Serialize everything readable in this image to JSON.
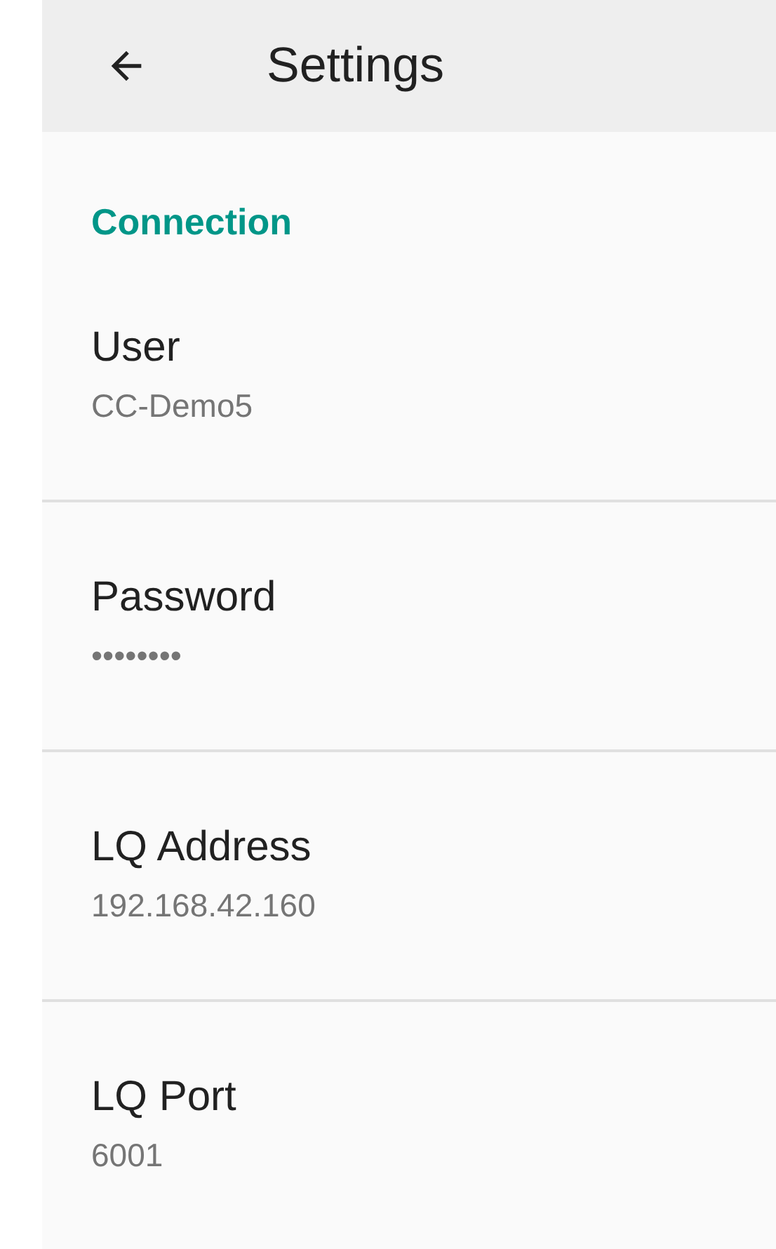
{
  "toolbar": {
    "title": "Settings"
  },
  "category": {
    "title": "Connection"
  },
  "preferences": [
    {
      "title": "User",
      "summary": "CC-Demo5"
    },
    {
      "title": "Password",
      "summary": "••••••••"
    },
    {
      "title": "LQ Address",
      "summary": "192.168.42.160"
    },
    {
      "title": "LQ Port",
      "summary": "6001"
    }
  ]
}
